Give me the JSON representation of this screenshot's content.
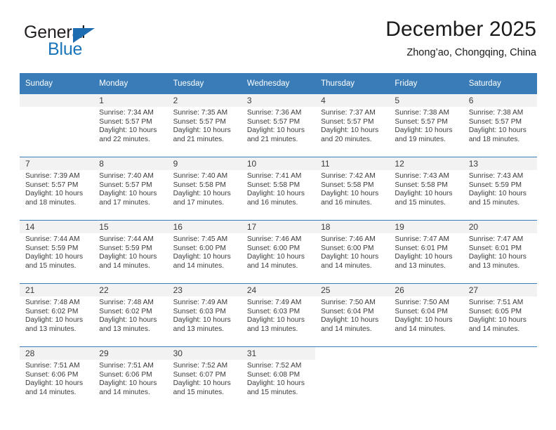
{
  "brand": {
    "name_part1": "General",
    "name_part2": "Blue",
    "logo_icon": "triangle-logo-icon",
    "accent_color": "#1b75bb"
  },
  "header": {
    "title": "December 2025",
    "location": "Zhong’ao, Chongqing, China"
  },
  "calendar": {
    "header_bg": "#3a7cb8",
    "daynum_bg": "#f2f2f2",
    "weekday_headers": [
      "Sunday",
      "Monday",
      "Tuesday",
      "Wednesday",
      "Thursday",
      "Friday",
      "Saturday"
    ],
    "weeks": [
      [
        {
          "day": "",
          "lines": []
        },
        {
          "day": "1",
          "lines": [
            "Sunrise: 7:34 AM",
            "Sunset: 5:57 PM",
            "Daylight: 10 hours",
            "and 22 minutes."
          ]
        },
        {
          "day": "2",
          "lines": [
            "Sunrise: 7:35 AM",
            "Sunset: 5:57 PM",
            "Daylight: 10 hours",
            "and 21 minutes."
          ]
        },
        {
          "day": "3",
          "lines": [
            "Sunrise: 7:36 AM",
            "Sunset: 5:57 PM",
            "Daylight: 10 hours",
            "and 21 minutes."
          ]
        },
        {
          "day": "4",
          "lines": [
            "Sunrise: 7:37 AM",
            "Sunset: 5:57 PM",
            "Daylight: 10 hours",
            "and 20 minutes."
          ]
        },
        {
          "day": "5",
          "lines": [
            "Sunrise: 7:38 AM",
            "Sunset: 5:57 PM",
            "Daylight: 10 hours",
            "and 19 minutes."
          ]
        },
        {
          "day": "6",
          "lines": [
            "Sunrise: 7:38 AM",
            "Sunset: 5:57 PM",
            "Daylight: 10 hours",
            "and 18 minutes."
          ]
        }
      ],
      [
        {
          "day": "7",
          "lines": [
            "Sunrise: 7:39 AM",
            "Sunset: 5:57 PM",
            "Daylight: 10 hours",
            "and 18 minutes."
          ]
        },
        {
          "day": "8",
          "lines": [
            "Sunrise: 7:40 AM",
            "Sunset: 5:57 PM",
            "Daylight: 10 hours",
            "and 17 minutes."
          ]
        },
        {
          "day": "9",
          "lines": [
            "Sunrise: 7:40 AM",
            "Sunset: 5:58 PM",
            "Daylight: 10 hours",
            "and 17 minutes."
          ]
        },
        {
          "day": "10",
          "lines": [
            "Sunrise: 7:41 AM",
            "Sunset: 5:58 PM",
            "Daylight: 10 hours",
            "and 16 minutes."
          ]
        },
        {
          "day": "11",
          "lines": [
            "Sunrise: 7:42 AM",
            "Sunset: 5:58 PM",
            "Daylight: 10 hours",
            "and 16 minutes."
          ]
        },
        {
          "day": "12",
          "lines": [
            "Sunrise: 7:43 AM",
            "Sunset: 5:58 PM",
            "Daylight: 10 hours",
            "and 15 minutes."
          ]
        },
        {
          "day": "13",
          "lines": [
            "Sunrise: 7:43 AM",
            "Sunset: 5:59 PM",
            "Daylight: 10 hours",
            "and 15 minutes."
          ]
        }
      ],
      [
        {
          "day": "14",
          "lines": [
            "Sunrise: 7:44 AM",
            "Sunset: 5:59 PM",
            "Daylight: 10 hours",
            "and 15 minutes."
          ]
        },
        {
          "day": "15",
          "lines": [
            "Sunrise: 7:44 AM",
            "Sunset: 5:59 PM",
            "Daylight: 10 hours",
            "and 14 minutes."
          ]
        },
        {
          "day": "16",
          "lines": [
            "Sunrise: 7:45 AM",
            "Sunset: 6:00 PM",
            "Daylight: 10 hours",
            "and 14 minutes."
          ]
        },
        {
          "day": "17",
          "lines": [
            "Sunrise: 7:46 AM",
            "Sunset: 6:00 PM",
            "Daylight: 10 hours",
            "and 14 minutes."
          ]
        },
        {
          "day": "18",
          "lines": [
            "Sunrise: 7:46 AM",
            "Sunset: 6:00 PM",
            "Daylight: 10 hours",
            "and 14 minutes."
          ]
        },
        {
          "day": "19",
          "lines": [
            "Sunrise: 7:47 AM",
            "Sunset: 6:01 PM",
            "Daylight: 10 hours",
            "and 13 minutes."
          ]
        },
        {
          "day": "20",
          "lines": [
            "Sunrise: 7:47 AM",
            "Sunset: 6:01 PM",
            "Daylight: 10 hours",
            "and 13 minutes."
          ]
        }
      ],
      [
        {
          "day": "21",
          "lines": [
            "Sunrise: 7:48 AM",
            "Sunset: 6:02 PM",
            "Daylight: 10 hours",
            "and 13 minutes."
          ]
        },
        {
          "day": "22",
          "lines": [
            "Sunrise: 7:48 AM",
            "Sunset: 6:02 PM",
            "Daylight: 10 hours",
            "and 13 minutes."
          ]
        },
        {
          "day": "23",
          "lines": [
            "Sunrise: 7:49 AM",
            "Sunset: 6:03 PM",
            "Daylight: 10 hours",
            "and 13 minutes."
          ]
        },
        {
          "day": "24",
          "lines": [
            "Sunrise: 7:49 AM",
            "Sunset: 6:03 PM",
            "Daylight: 10 hours",
            "and 13 minutes."
          ]
        },
        {
          "day": "25",
          "lines": [
            "Sunrise: 7:50 AM",
            "Sunset: 6:04 PM",
            "Daylight: 10 hours",
            "and 14 minutes."
          ]
        },
        {
          "day": "26",
          "lines": [
            "Sunrise: 7:50 AM",
            "Sunset: 6:04 PM",
            "Daylight: 10 hours",
            "and 14 minutes."
          ]
        },
        {
          "day": "27",
          "lines": [
            "Sunrise: 7:51 AM",
            "Sunset: 6:05 PM",
            "Daylight: 10 hours",
            "and 14 minutes."
          ]
        }
      ],
      [
        {
          "day": "28",
          "lines": [
            "Sunrise: 7:51 AM",
            "Sunset: 6:06 PM",
            "Daylight: 10 hours",
            "and 14 minutes."
          ]
        },
        {
          "day": "29",
          "lines": [
            "Sunrise: 7:51 AM",
            "Sunset: 6:06 PM",
            "Daylight: 10 hours",
            "and 14 minutes."
          ]
        },
        {
          "day": "30",
          "lines": [
            "Sunrise: 7:52 AM",
            "Sunset: 6:07 PM",
            "Daylight: 10 hours",
            "and 15 minutes."
          ]
        },
        {
          "day": "31",
          "lines": [
            "Sunrise: 7:52 AM",
            "Sunset: 6:08 PM",
            "Daylight: 10 hours",
            "and 15 minutes."
          ]
        },
        {
          "day": "",
          "lines": [],
          "blank": true
        },
        {
          "day": "",
          "lines": [],
          "blank": true
        },
        {
          "day": "",
          "lines": [],
          "blank": true
        }
      ]
    ]
  }
}
